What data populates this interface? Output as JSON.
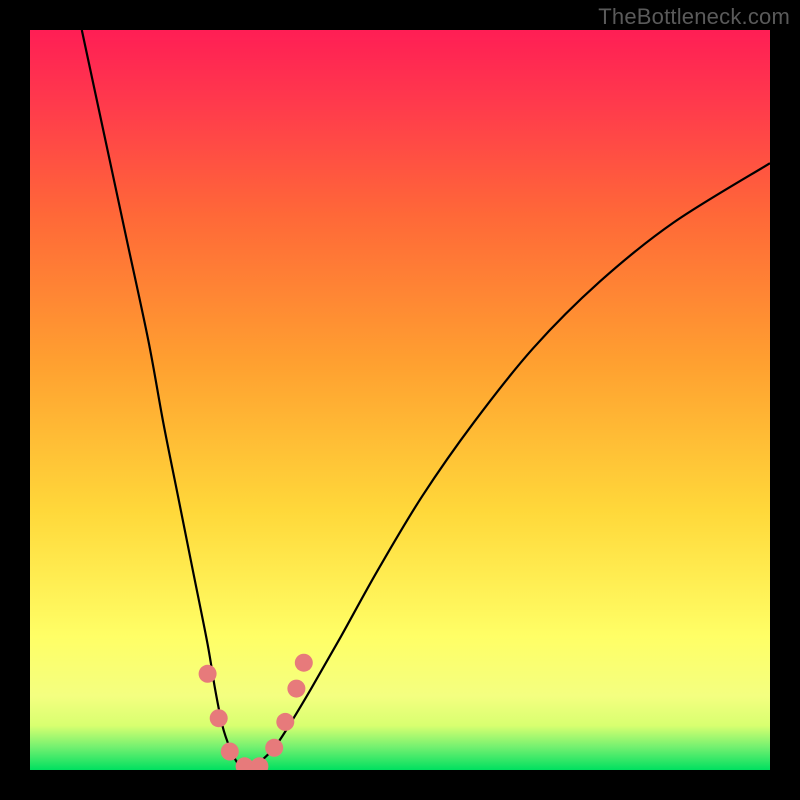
{
  "watermark": "TheBottleneck.com",
  "chart_data": {
    "type": "line",
    "title": "",
    "xlabel": "",
    "ylabel": "",
    "xlim": [
      0,
      100
    ],
    "ylim": [
      0,
      100
    ],
    "background_gradient_stops": [
      {
        "pos": 0.0,
        "color": "#00E060"
      },
      {
        "pos": 0.03,
        "color": "#70F070"
      },
      {
        "pos": 0.06,
        "color": "#D8FF70"
      },
      {
        "pos": 0.1,
        "color": "#F4FF80"
      },
      {
        "pos": 0.18,
        "color": "#FFFF66"
      },
      {
        "pos": 0.35,
        "color": "#FFD83A"
      },
      {
        "pos": 0.55,
        "color": "#FFA030"
      },
      {
        "pos": 0.75,
        "color": "#FF6838"
      },
      {
        "pos": 0.9,
        "color": "#FF3A4C"
      },
      {
        "pos": 1.0,
        "color": "#FF1E55"
      }
    ],
    "series": [
      {
        "name": "bottleneck-curve",
        "color": "#000000",
        "x": [
          7,
          10,
          13,
          16,
          18,
          20,
          22,
          24,
          25,
          26,
          27,
          28,
          29,
          30,
          31,
          33,
          35,
          38,
          42,
          47,
          53,
          60,
          68,
          77,
          87,
          100
        ],
        "values": [
          100,
          86,
          72,
          58,
          47,
          37,
          27,
          17,
          11,
          6,
          3,
          1,
          0,
          0,
          1,
          3,
          6,
          11,
          18,
          27,
          37,
          47,
          57,
          66,
          74,
          82
        ]
      }
    ],
    "markers": {
      "name": "highlight-dots",
      "color": "#E77A7B",
      "radius_px": 9,
      "points": [
        {
          "x": 24.0,
          "y": 13.0
        },
        {
          "x": 25.5,
          "y": 7.0
        },
        {
          "x": 27.0,
          "y": 2.5
        },
        {
          "x": 29.0,
          "y": 0.5
        },
        {
          "x": 31.0,
          "y": 0.5
        },
        {
          "x": 33.0,
          "y": 3.0
        },
        {
          "x": 34.5,
          "y": 6.5
        },
        {
          "x": 36.0,
          "y": 11.0
        },
        {
          "x": 37.0,
          "y": 14.5
        }
      ]
    }
  }
}
